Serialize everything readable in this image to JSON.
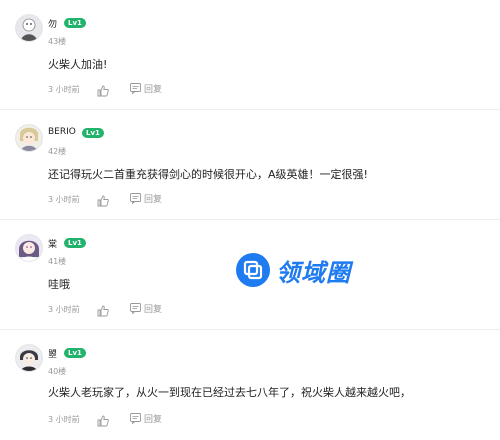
{
  "labels": {
    "time": "3 小时前",
    "reply": "回复",
    "level_badge": "Lv1"
  },
  "comments": [
    {
      "username": "勿",
      "floor": "43楼",
      "content": "火柴人加油!"
    },
    {
      "username": "BERIO",
      "floor": "42楼",
      "content": "还记得玩火二首重充获得剑心的时候很开心，A级英雄！一定很强!"
    },
    {
      "username": "棠",
      "floor": "41楼",
      "content": "哇哦"
    },
    {
      "username": "曌",
      "floor": "40楼",
      "content": "火柴人老玩家了，从火一到现在已经过去七八年了，祝火柴人越来越火吧，"
    }
  ],
  "watermark": {
    "text": "领域圈"
  },
  "colors": {
    "level_badge": "#21b36b",
    "watermark": "#1f7bf0",
    "muted": "#999999"
  }
}
